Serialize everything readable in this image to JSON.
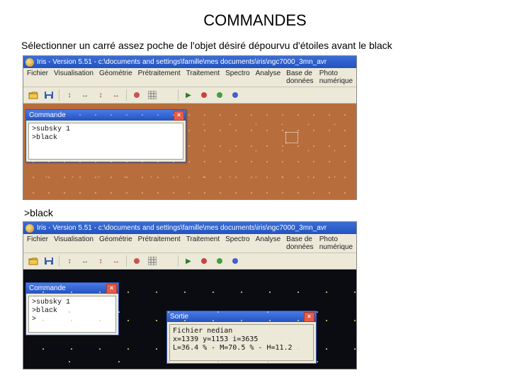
{
  "page": {
    "title": "COMMANDES",
    "instruction": "Sélectionner un carré assez poche de l'objet désiré dépourvu d'étoiles avant le black",
    "cmd_label": ">black"
  },
  "shot1": {
    "title": "Iris - Version 5.51 - c:\\documents and settings\\famille\\mes documents\\iris\\ngc7000_3mn_avr",
    "menu": [
      "Fichier",
      "Visualisation",
      "Géométrie",
      "Prétraitement",
      "Traitement",
      "Spectro",
      "Analyse",
      "Base de données",
      "Photo numérique"
    ],
    "commande": {
      "title": "Commande",
      "lines": ">subsky 1\n>black"
    }
  },
  "shot2": {
    "title": "Iris - Version 5.51 - c:\\documents and settings\\famille\\mes documents\\iris\\ngc7000_3mn_avr",
    "menu": [
      "Fichier",
      "Visualisation",
      "Géométrie",
      "Prétraitement",
      "Traitement",
      "Spectro",
      "Analyse",
      "Base de données",
      "Photo numérique"
    ],
    "commande": {
      "title": "Commande",
      "lines": ">subsky 1\n>black\n>"
    },
    "sortie": {
      "title": "Sortie",
      "lines": "Fichier nedian\nx=1339 y=1153 i=3635\nL=36.4 % - M=70.5 % - H=11.2"
    }
  },
  "icons": {
    "open": "folder-icon",
    "save": "disk-icon"
  }
}
